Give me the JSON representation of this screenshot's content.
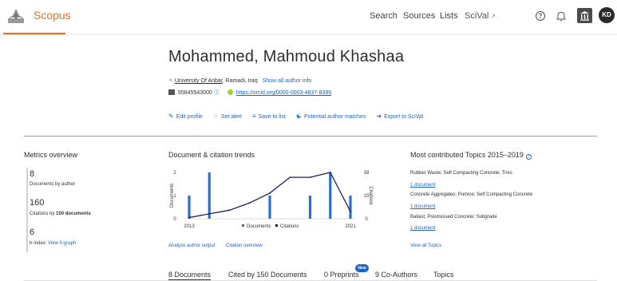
{
  "header": {
    "brand": "Scopus",
    "nav": {
      "search": "Search",
      "sources": "Sources",
      "lists": "Lists",
      "scival": "SciVal",
      "scival_ext": "↗"
    },
    "avatar_initials": "KD",
    "accent_color": "#e9711c"
  },
  "profile": {
    "name": "Mohammed, Mahmoud Khashaa",
    "affiliation": "University Of Anbar",
    "location": ", Ramadi, Iraq",
    "show_all": "Show all author info",
    "author_id": "55845543000",
    "orcid": "https://orcid.org/0000-0003-4837-8396",
    "actions": {
      "edit": "Edit profile",
      "alert": "Set alert",
      "save": "Save to list",
      "matches": "Potential author matches",
      "export": "Export to SciVal"
    }
  },
  "metrics": {
    "title": "Metrics overview",
    "documents_value": "8",
    "documents_label": "Documents by author",
    "citations_value": "160",
    "citations_label_pre": "Citations by ",
    "citations_label_bold": "150 documents",
    "hindex_value": "6",
    "hindex_label": "h-index:",
    "hindex_link": "View h-graph"
  },
  "trends": {
    "title": "Document & citation trends",
    "analyze_link": "Analyze author output",
    "citation_link": "Citation overview"
  },
  "chart_data": {
    "type": "bar",
    "x": [
      "2013",
      "2014",
      "2015",
      "2016",
      "2017",
      "2018",
      "2019",
      "2020",
      "2021"
    ],
    "x_tick_labels": [
      "2013",
      "2021"
    ],
    "series": [
      {
        "name": "Documents",
        "kind": "bar",
        "axis": "left",
        "values": [
          1,
          2,
          0,
          0,
          1,
          0,
          1,
          2,
          1
        ],
        "color": "#2a6ed8"
      },
      {
        "name": "Citations",
        "kind": "line",
        "axis": "right",
        "values": [
          1,
          4,
          7,
          13,
          21,
          34,
          34,
          38,
          6
        ],
        "color": "#1f1d5c"
      }
    ],
    "ylabel": "Documents",
    "y2label": "Citations",
    "ylim": [
      0,
      2
    ],
    "y_ticks": [
      "0",
      "1",
      "2"
    ],
    "y2lim": [
      0,
      38
    ],
    "y2_ticks": [
      "0",
      "19",
      "38"
    ],
    "legend": "bottom"
  },
  "topics": {
    "title": "Most contributed Topics 2015–2019",
    "info": "i",
    "items": [
      {
        "name": "Rubber Waste; Self Compacting Concrete; Tires",
        "docs": "1 document"
      },
      {
        "name": "Concrete Aggregates; Pumice; Self Compacting Concrete",
        "docs": "1 document"
      },
      {
        "name": "Ballast; Prestressed Concrete; Subgrade",
        "docs": "1 document"
      }
    ],
    "view_all": "View all Topics"
  },
  "tabs": {
    "documents": "8 Documents",
    "cited_by": "Cited by 150 Documents",
    "preprints": "0 Preprints",
    "new_badge": "New",
    "coauthors": "9 Co-Authors",
    "topics": "Topics"
  }
}
